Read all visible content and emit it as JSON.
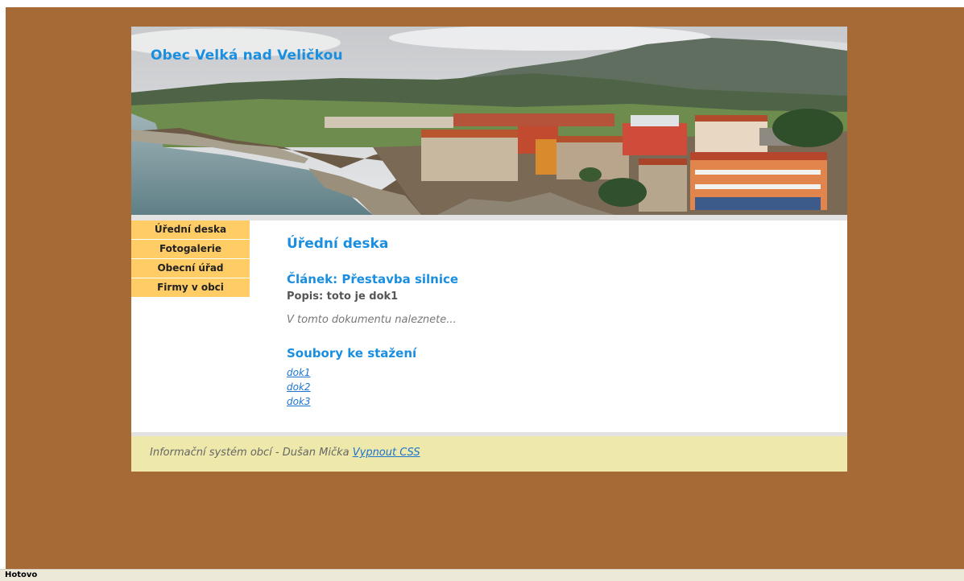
{
  "site": {
    "title": "Obec Velká nad Veličkou"
  },
  "banner": {
    "image": "coastal-town-panorama"
  },
  "menu": {
    "items": [
      {
        "label": "Úřední deska"
      },
      {
        "label": "Fotogalerie"
      },
      {
        "label": "Obecní úřad"
      },
      {
        "label": "Firmy v obci"
      }
    ]
  },
  "content": {
    "heading": "Úřední deska",
    "article_title": "Článek: Přestavba silnice",
    "article_description": "Popis: toto je dok1",
    "article_text": "V tomto dokumentu naleznete...",
    "downloads_heading": "Soubory ke stažení",
    "downloads": [
      {
        "label": "dok1"
      },
      {
        "label": "dok2"
      },
      {
        "label": "dok3"
      }
    ]
  },
  "footer": {
    "text": "Informační systém obcí - Dušan Mička",
    "css_toggle_label": "Vypnout CSS"
  },
  "statusbar": {
    "text": "Hotovo"
  },
  "colors": {
    "page_background": "#a66a37",
    "accent_blue": "#1a8fe0",
    "menu_background": "#ffcc66",
    "footer_background": "#eee8aa"
  }
}
